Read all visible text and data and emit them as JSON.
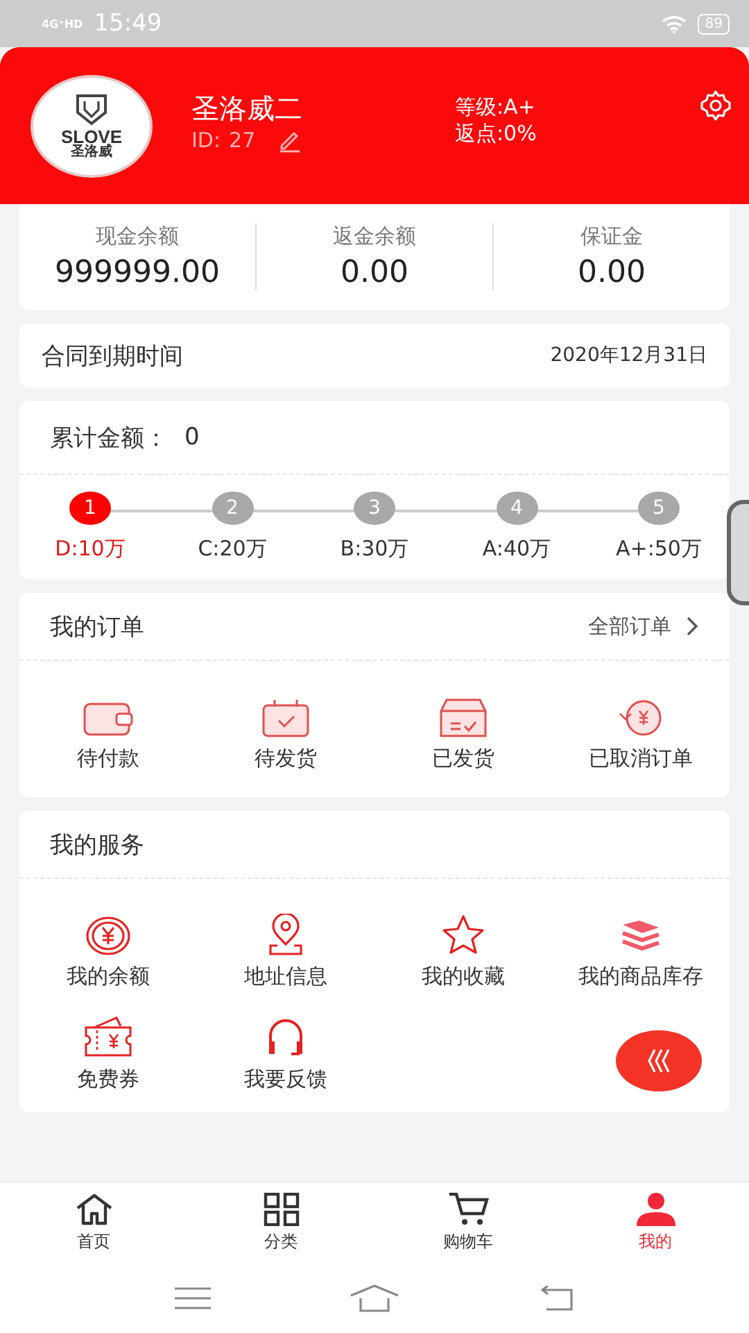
{
  "status_bar": {
    "network": "4G⁺HD",
    "time": "15:49",
    "battery": "89"
  },
  "profile": {
    "name": "圣洛威二",
    "id_label": "ID:",
    "id": "27",
    "logo_text": "SLOVE",
    "logo_subtext": "圣洛威",
    "grade": "等级:A+",
    "rebate": "返点:0%"
  },
  "balances": [
    {
      "label": "现金余额",
      "value": "999999.00"
    },
    {
      "label": "返金余额",
      "value": "0.00"
    },
    {
      "label": "保证金",
      "value": "0.00"
    }
  ],
  "contract": {
    "label": "合同到期时间",
    "value": "2020年12月31日"
  },
  "cumulative": {
    "label": "累计金额：",
    "value": "0"
  },
  "levels": [
    {
      "number": "1",
      "label": "D:10万",
      "selected": true
    },
    {
      "number": "2",
      "label": "C:20万",
      "selected": false
    },
    {
      "number": "3",
      "label": "B:30万",
      "selected": false
    },
    {
      "number": "4",
      "label": "A:40万",
      "selected": false
    },
    {
      "number": "5",
      "label": "A+:50万",
      "selected": false
    }
  ],
  "orders": {
    "title": "我的订单",
    "all_link": "全部订单",
    "items": [
      {
        "kind": "wallet",
        "label": "待付款"
      },
      {
        "kind": "calendar",
        "label": "待发货"
      },
      {
        "kind": "box",
        "label": "已发货"
      },
      {
        "kind": "refund",
        "label": "已取消订单"
      }
    ]
  },
  "services": {
    "title": "我的服务",
    "items": [
      {
        "kind": "coin",
        "label": "我的余额"
      },
      {
        "kind": "location",
        "label": "地址信息"
      },
      {
        "kind": "star",
        "label": "我的收藏"
      },
      {
        "kind": "stack",
        "label": "我的商品库存"
      },
      {
        "kind": "ticket",
        "label": "免费券"
      },
      {
        "kind": "headset",
        "label": "我要反馈"
      }
    ]
  },
  "tab_bar": [
    {
      "kind": "home",
      "label": "首页",
      "selected": false
    },
    {
      "kind": "grid",
      "label": "分类",
      "selected": false
    },
    {
      "kind": "cart",
      "label": "购物车",
      "selected": false
    },
    {
      "kind": "person",
      "label": "我的",
      "selected": true
    }
  ]
}
